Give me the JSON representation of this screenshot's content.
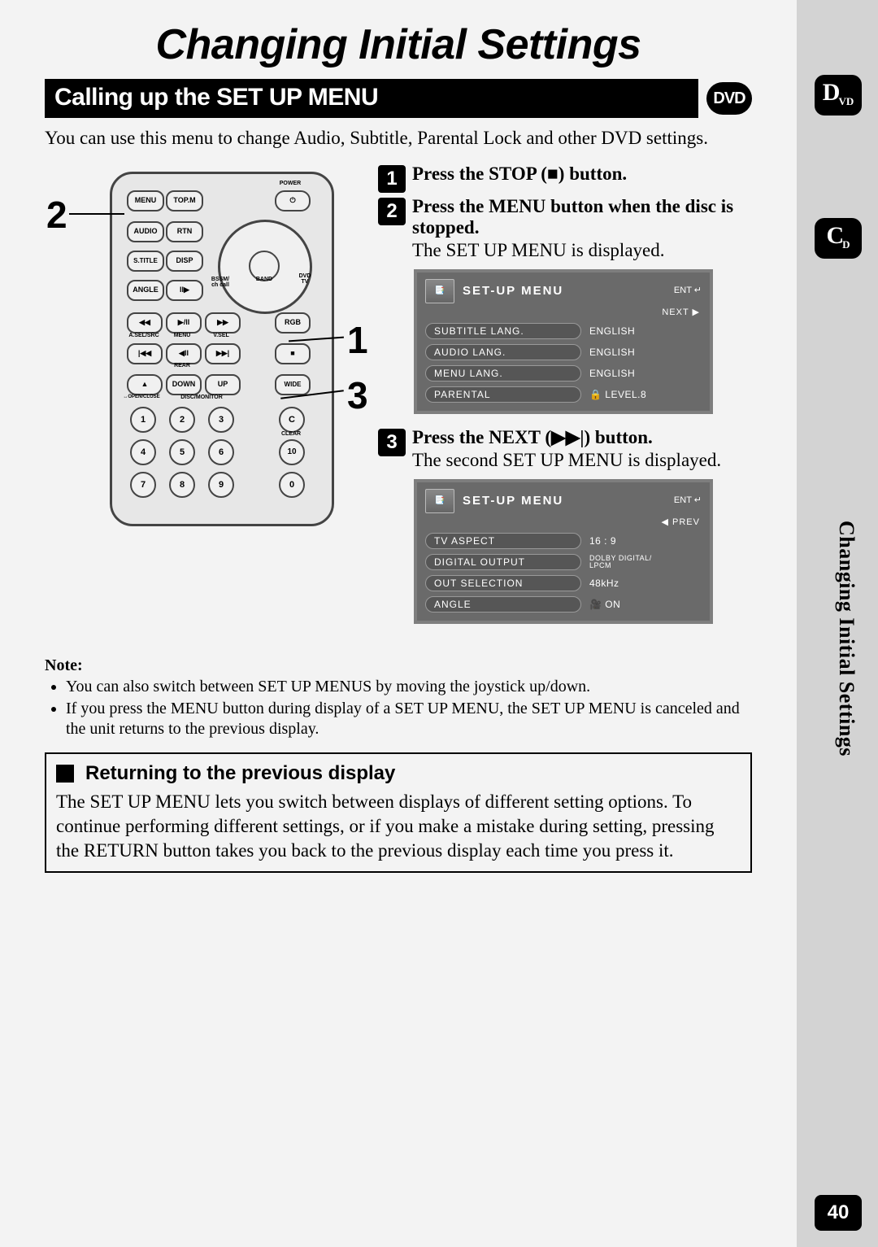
{
  "page": {
    "main_title": "Changing Initial Settings",
    "section_heading": "Calling up the SET UP MENU",
    "dvd_badge": "DVD",
    "intro": "You can use this menu to change Audio, Subtitle, Parental Lock and other DVD settings.",
    "vertical_title": "Changing Initial Settings",
    "page_number": "40"
  },
  "side_tabs": {
    "dvd_c": "D",
    "dvd_sub": "VD",
    "cd_c": "C",
    "cd_sub": "D"
  },
  "remote": {
    "num_2": "2",
    "num_1": "1",
    "num_3": "3",
    "labels": {
      "power": "POWER",
      "menu": "MENU",
      "topm": "TOP.M",
      "audio": "AUDIO",
      "rtn": "RTN",
      "stitle": "S.TITLE",
      "disp": "DISP",
      "angle": "ANGLE",
      "bssm": "BSSM/\nch call",
      "band": "BAND",
      "dvd_tv": "DVD\nTV",
      "rgb": "RGB",
      "asel": "A.SEL/SRC",
      "menul": "MENU",
      "vsel": "V.SEL",
      "rear": "REAR",
      "down": "DOWN",
      "up": "UP",
      "wide": "WIDE",
      "open": "OPEN/CLOSE",
      "discmon": "DISC/MONITOR",
      "clear": "CLEAR",
      "n1": "1",
      "n2": "2",
      "n3": "3",
      "n4": "4",
      "n5": "5",
      "n6": "6",
      "n7": "7",
      "n8": "8",
      "n9": "9",
      "n0": "0",
      "n10": "10",
      "nc": "C"
    }
  },
  "steps": [
    {
      "badge": "1",
      "head": "Press the STOP (■) button.",
      "desc": ""
    },
    {
      "badge": "2",
      "head": "Press the MENU button when the disc is stopped.",
      "desc": "The SET UP MENU is displayed."
    },
    {
      "badge": "3",
      "head": "Press the NEXT (▶▶|) button.",
      "desc": "The second SET UP MENU is displayed."
    }
  ],
  "screenshot1": {
    "title": "SET-UP MENU",
    "ent": "ENT ↵",
    "sub": "NEXT ▶",
    "rows": [
      {
        "label": "SUBTITLE LANG.",
        "value": "ENGLISH"
      },
      {
        "label": "AUDIO LANG.",
        "value": "ENGLISH"
      },
      {
        "label": "MENU LANG.",
        "value": "ENGLISH"
      },
      {
        "label": "PARENTAL",
        "value": "🔒 LEVEL.8"
      }
    ]
  },
  "screenshot2": {
    "title": "SET-UP MENU",
    "ent": "ENT ↵",
    "sub": "◀ PREV",
    "rows": [
      {
        "label": "TV ASPECT",
        "value": "16 : 9"
      },
      {
        "label": "DIGITAL OUTPUT",
        "value": "DOLBY DIGITAL/\nLPCM"
      },
      {
        "label": "OUT SELECTION",
        "value": "48kHz"
      },
      {
        "label": "ANGLE",
        "value": "🎥 ON"
      }
    ]
  },
  "note": {
    "head": "Note:",
    "items": [
      "You can also switch between SET UP MENUS by moving the joystick up/down.",
      "If you press the MENU button during display of a SET UP MENU, the SET UP MENU is canceled and the unit returns to the previous display."
    ]
  },
  "return": {
    "head": "Returning to the previous display",
    "body": "The SET UP MENU lets you switch between displays of different setting options. To continue performing different settings, or if you make a mistake during setting, pressing the RETURN button takes you back to the previous display each time you press it."
  }
}
